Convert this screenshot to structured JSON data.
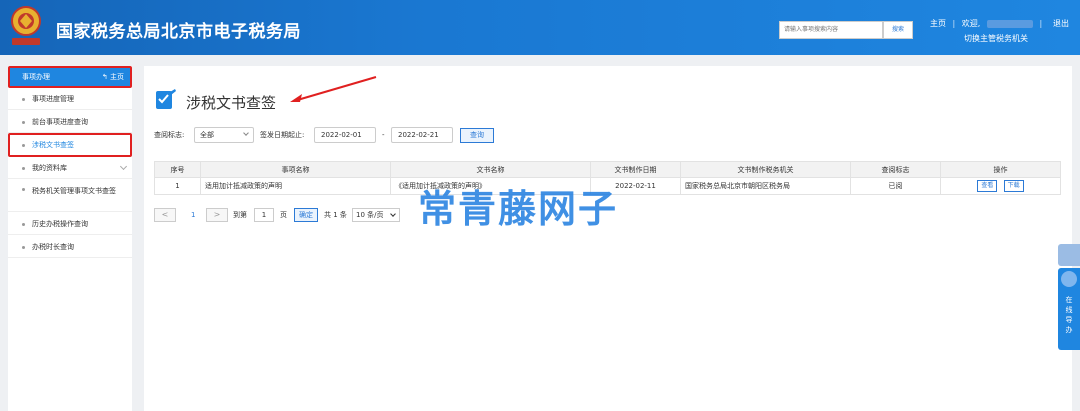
{
  "header": {
    "title": "国家税务总局北京市电子税务局",
    "search_placeholder": "请输入事项搜索内容",
    "search_button": "搜索",
    "home": "主页",
    "separator": "|",
    "welcome": "欢迎,",
    "switch_org": "切换主管税务机关",
    "logout": "退出"
  },
  "sidebar": {
    "head_label": "事项办理",
    "home_label": "主页",
    "items": [
      {
        "label": "事项进度管理"
      },
      {
        "label": "前台事项进度查询"
      },
      {
        "label": "涉税文书查签"
      },
      {
        "label": "我的资料库"
      },
      {
        "label": "税务机关管理事项文书查签"
      },
      {
        "label": "历史办税操作查询"
      },
      {
        "label": "办税时长查询"
      }
    ]
  },
  "main": {
    "title": "涉税文书查签",
    "filter": {
      "status_label": "查阅标志:",
      "status_value": "全部",
      "date_label": "签发日期起止:",
      "date_from": "2022-02-01",
      "date_dash": "-",
      "date_to": "2022-02-21",
      "query_button": "查询"
    },
    "table": {
      "headers": [
        "序号",
        "事项名称",
        "文书名称",
        "文书制作日期",
        "文书制作税务机关",
        "查阅标志",
        "操作"
      ],
      "rows": [
        {
          "index": "1",
          "item_name": "适用加计抵减政策的声明",
          "doc_name": "《适用加计抵减政策的声明》",
          "doc_date": "2022-02-11",
          "doc_org": "国家税务总局北京市朝阳区税务局",
          "read_flag": "已阅",
          "view_label": "查看",
          "download_label": "下载"
        }
      ]
    },
    "pager": {
      "prev": "<",
      "current": "1",
      "next": ">",
      "goto_label": "到第",
      "goto_value": "1",
      "page_unit": "页",
      "confirm": "确定",
      "total": "共 1 条",
      "page_size": "10 条/页"
    }
  },
  "watermark": "常青藤网子",
  "float_panel": {
    "label": "在线导办"
  },
  "colors": {
    "brand": "#1f86e0",
    "highlight": "#e02020"
  }
}
